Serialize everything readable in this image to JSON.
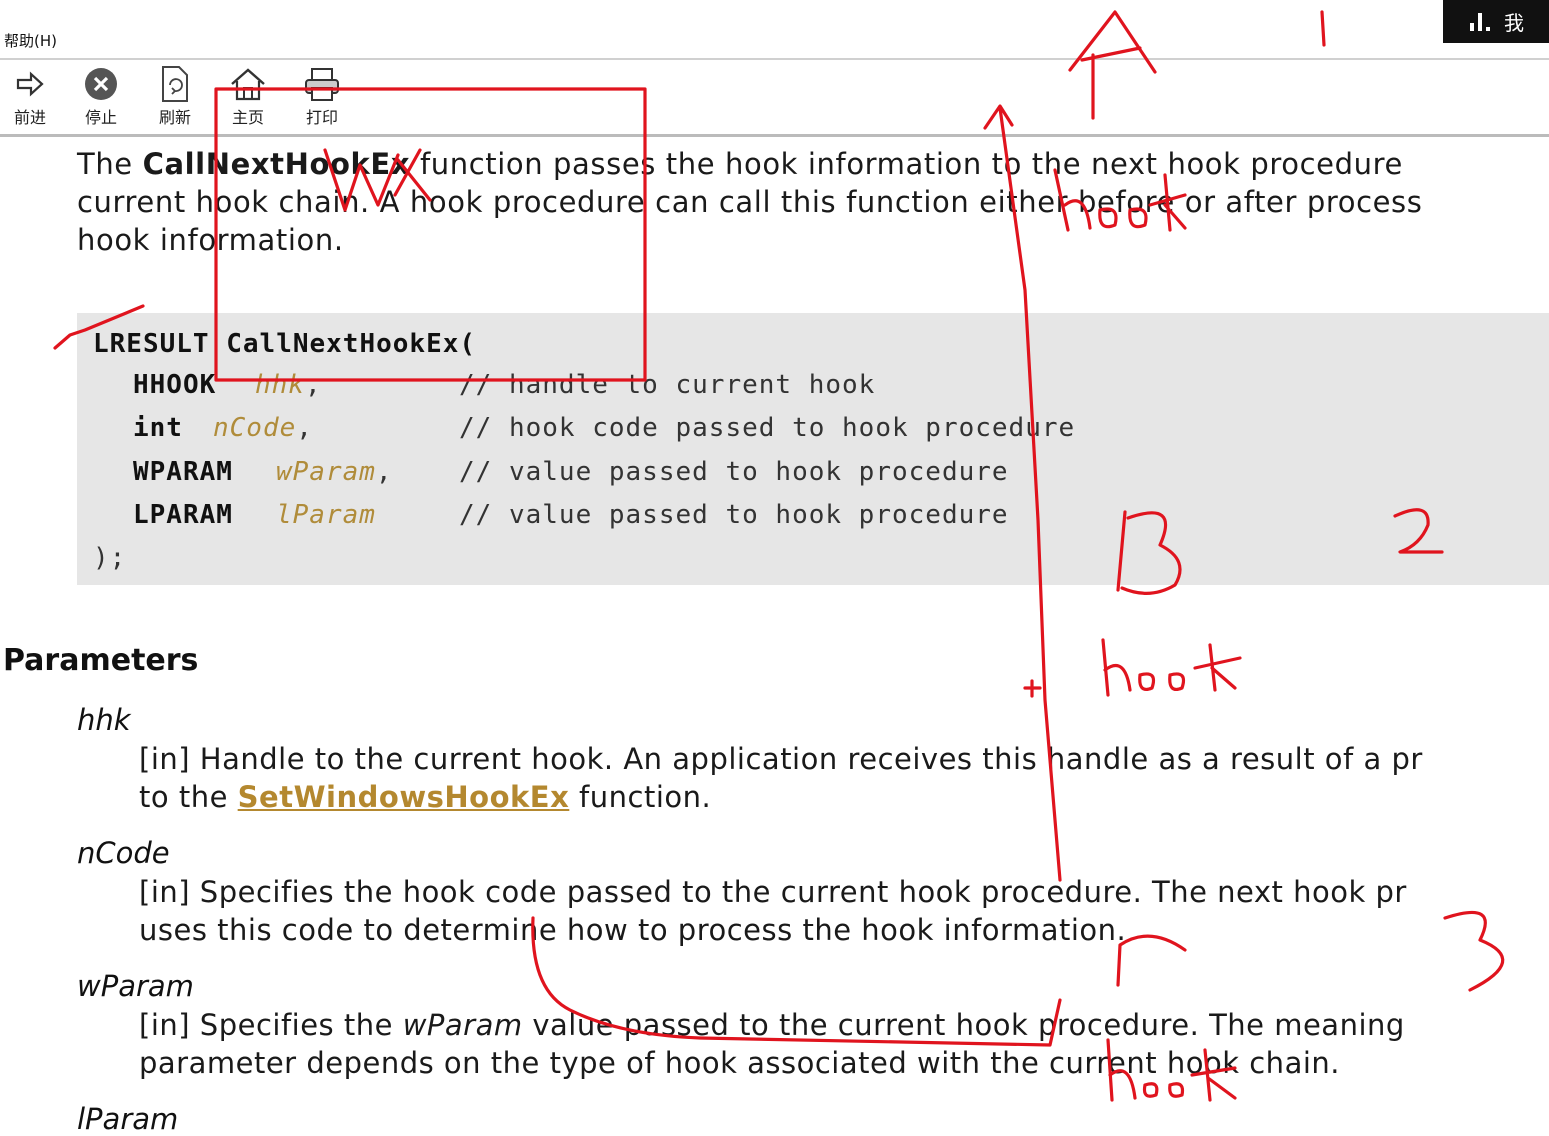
{
  "menubar": {
    "help_label": "帮助(H)",
    "tray_text": "我"
  },
  "toolbar": {
    "buttons": [
      {
        "label": "前进",
        "icon": "forward-arrow-icon"
      },
      {
        "label": "停止",
        "icon": "stop-icon"
      },
      {
        "label": "刷新",
        "icon": "refresh-icon"
      },
      {
        "label": "主页",
        "icon": "home-icon"
      },
      {
        "label": "打印",
        "icon": "print-icon"
      }
    ]
  },
  "doc": {
    "desc_prefix": "The ",
    "func_name": "CallNextHookEx",
    "desc_line1": " function passes the hook information to the next hook procedure",
    "desc_line2": "current hook chain. A hook procedure can call this function either before or after process",
    "desc_line3": "hook information.",
    "code": {
      "signature_type": "LRESULT",
      "signature_name": " CallNextHookEx(",
      "params": [
        {
          "type": "HHOOK",
          "name": "hhk",
          "sep": ",",
          "comment": "// handle to current hook"
        },
        {
          "type": "int",
          "name": "nCode",
          "sep": ",",
          "comment": "// hook code passed to hook procedure"
        },
        {
          "type": "WPARAM",
          "name": "wParam",
          "sep": ",",
          "comment": "// value passed to hook procedure"
        },
        {
          "type": "LPARAM",
          "name": "lParam",
          "sep": "",
          "comment": "// value passed to hook procedure"
        }
      ],
      "close": ");"
    },
    "parameters_heading": "Parameters",
    "parameters": [
      {
        "name": "hhk",
        "line1": "[in] Handle to the current hook. An application receives this handle as a result of a pr",
        "line2_prefix": "to the ",
        "link": "SetWindowsHookEx",
        "line2_suffix": " function."
      },
      {
        "name": "nCode",
        "line1": "[in] Specifies the hook code passed to the current hook procedure. The next hook pr",
        "line2": "uses this code to determine how to process the hook information."
      },
      {
        "name": "wParam",
        "line1_prefix": "[in] Specifies the ",
        "line1_em": "wParam",
        "line1_suffix": " value passed to the current hook procedure. The meaning",
        "line2": "parameter depends on the type of hook associated with the current hook chain."
      },
      {
        "name": "lParam"
      }
    ]
  },
  "annotations": [
    "A",
    "hook",
    "B",
    "hook",
    "C",
    "hook",
    "1",
    "2",
    "3"
  ]
}
